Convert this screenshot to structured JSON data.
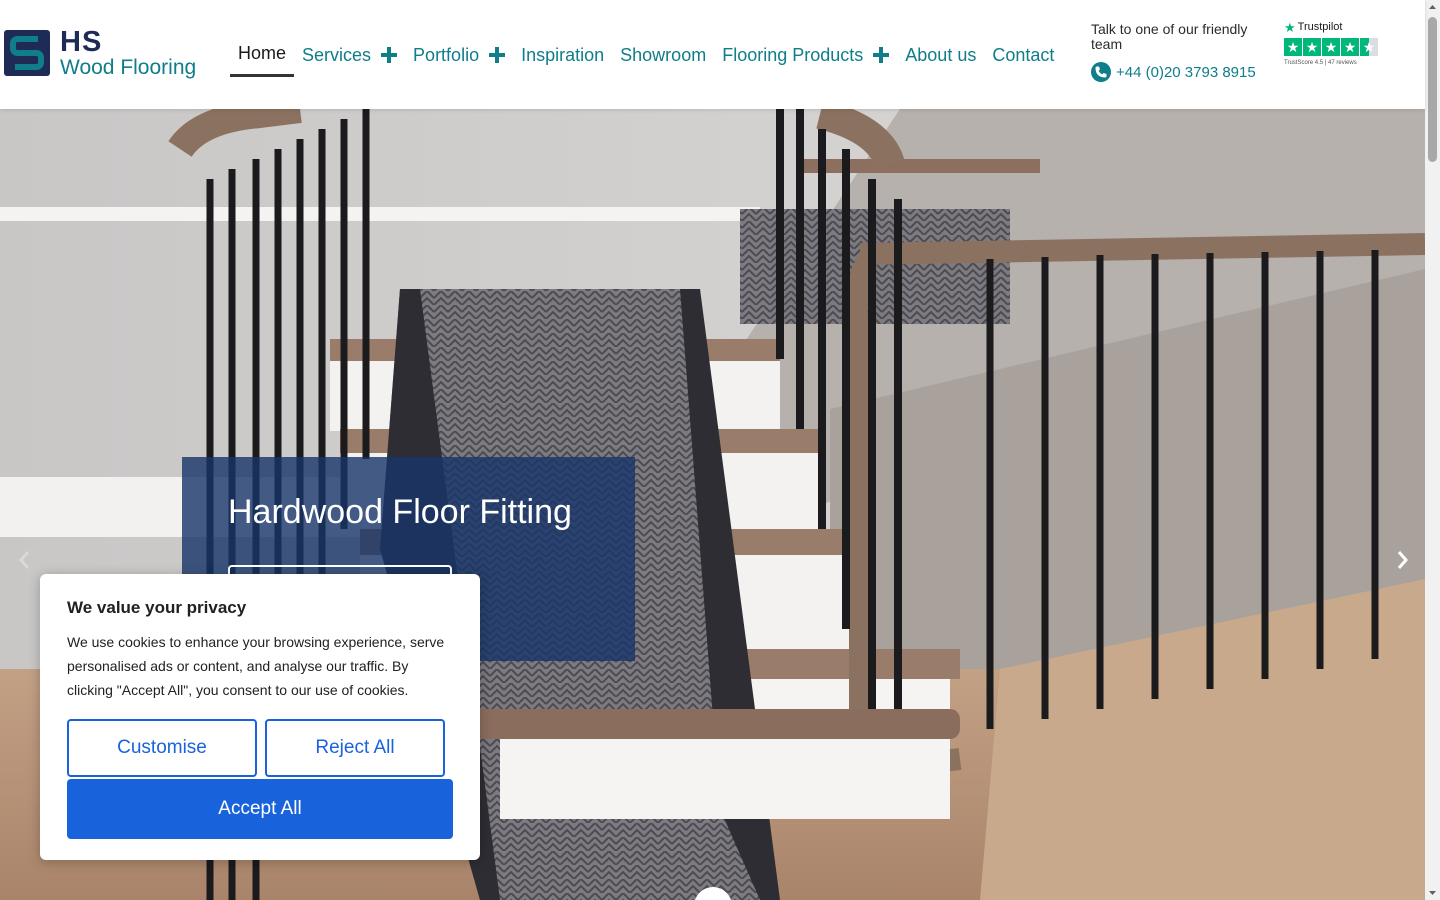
{
  "header": {
    "logo": {
      "mark": "S",
      "line1": "HS",
      "line2": "Wood Flooring"
    },
    "nav": [
      {
        "label": "Home",
        "active": true,
        "expandable": false
      },
      {
        "label": "Services",
        "active": false,
        "expandable": true
      },
      {
        "label": "Portfolio",
        "active": false,
        "expandable": true
      },
      {
        "label": "Inspiration",
        "active": false,
        "expandable": false
      },
      {
        "label": "Showroom",
        "active": false,
        "expandable": false
      },
      {
        "label": "Flooring Products",
        "active": false,
        "expandable": true
      },
      {
        "label": "About us",
        "active": false,
        "expandable": false
      },
      {
        "label": "Contact",
        "active": false,
        "expandable": false
      }
    ],
    "contact": {
      "tagline": "Talk to one of our friendly team",
      "phone": "+44 (0)20 3793 8915",
      "icon": "phone-icon"
    },
    "trustpilot": {
      "brand": "Trustpilot",
      "stars": 4.5,
      "score_text": "TrustScore 4.5 | 47 reviews"
    }
  },
  "hero": {
    "caption_title": "Hardwood Floor Fitting",
    "icons": {
      "prev": "chevron-left-icon",
      "next": "chevron-right-icon"
    }
  },
  "cookie_banner": {
    "title": "We value your privacy",
    "text": "We use cookies to enhance your browsing experience, serve personalised ads or content, and analyse our traffic. By clicking \"Accept All\", you consent to our use of cookies.",
    "customise_label": "Customise",
    "reject_label": "Reject All",
    "accept_label": "Accept All"
  },
  "colors": {
    "brand_teal": "#0f7d8a",
    "brand_navy": "#1d2b55",
    "caption_bg": "#163469",
    "cookie_blue": "#1863dc",
    "trustpilot_green": "#00b67a"
  }
}
